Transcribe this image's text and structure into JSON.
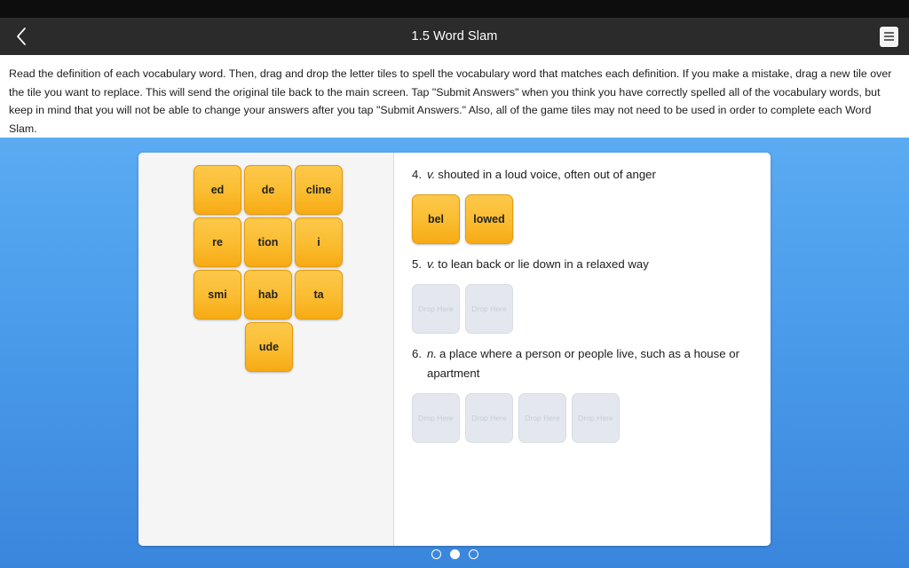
{
  "app_bar": {
    "title": "1.5 Word Slam",
    "back_icon": "chevron-left-icon",
    "menu_icon": "list-menu-icon"
  },
  "instructions": {
    "text": "Read the definition of each vocabulary word. Then, drag and drop the letter tiles to spell the vocabulary word that matches each definition. If you make a mistake, drag a new tile over the tile you want to replace. This will send the original tile back to the main screen. Tap \"Submit Answers\" when you think you have correctly spelled all of the vocabulary words, but keep in mind that you will not be able to change your answers after you tap \"Submit Answers.\" Also, all of the game tiles may not need to be used in order to complete each Word Slam."
  },
  "tray": {
    "rows": [
      [
        "ed",
        "de",
        "cline"
      ],
      [
        "re",
        "tion",
        "i"
      ],
      [
        "smi",
        "hab",
        "ta"
      ],
      [
        "ude"
      ]
    ]
  },
  "definitions": [
    {
      "number": "4.",
      "pos": "v.",
      "text": "shouted in a loud voice, often out of anger",
      "slots": [
        {
          "filled": true,
          "label": "bel"
        },
        {
          "filled": true,
          "label": "lowed"
        }
      ]
    },
    {
      "number": "5.",
      "pos": "v.",
      "text": "to lean back or lie down in a relaxed way",
      "slots": [
        {
          "filled": false,
          "label": "Drop Here"
        },
        {
          "filled": false,
          "label": "Drop Here"
        }
      ]
    },
    {
      "number": "6.",
      "pos": "n.",
      "text": "a place where a person or people live, such as a house or apartment",
      "slots": [
        {
          "filled": false,
          "label": "Drop Here"
        },
        {
          "filled": false,
          "label": "Drop Here"
        },
        {
          "filled": false,
          "label": "Drop Here"
        },
        {
          "filled": false,
          "label": "Drop Here"
        }
      ]
    }
  ],
  "pager": {
    "total": 3,
    "active_index": 1
  },
  "colors": {
    "tile": "#fbbe34",
    "tile_border": "#e49a0d",
    "slot_empty": "#e4e8ee",
    "background_top": "#5aabf2",
    "background_bottom": "#3b86dd",
    "app_bar": "#2b2b2b",
    "status_bar": "#0d0d0d"
  }
}
